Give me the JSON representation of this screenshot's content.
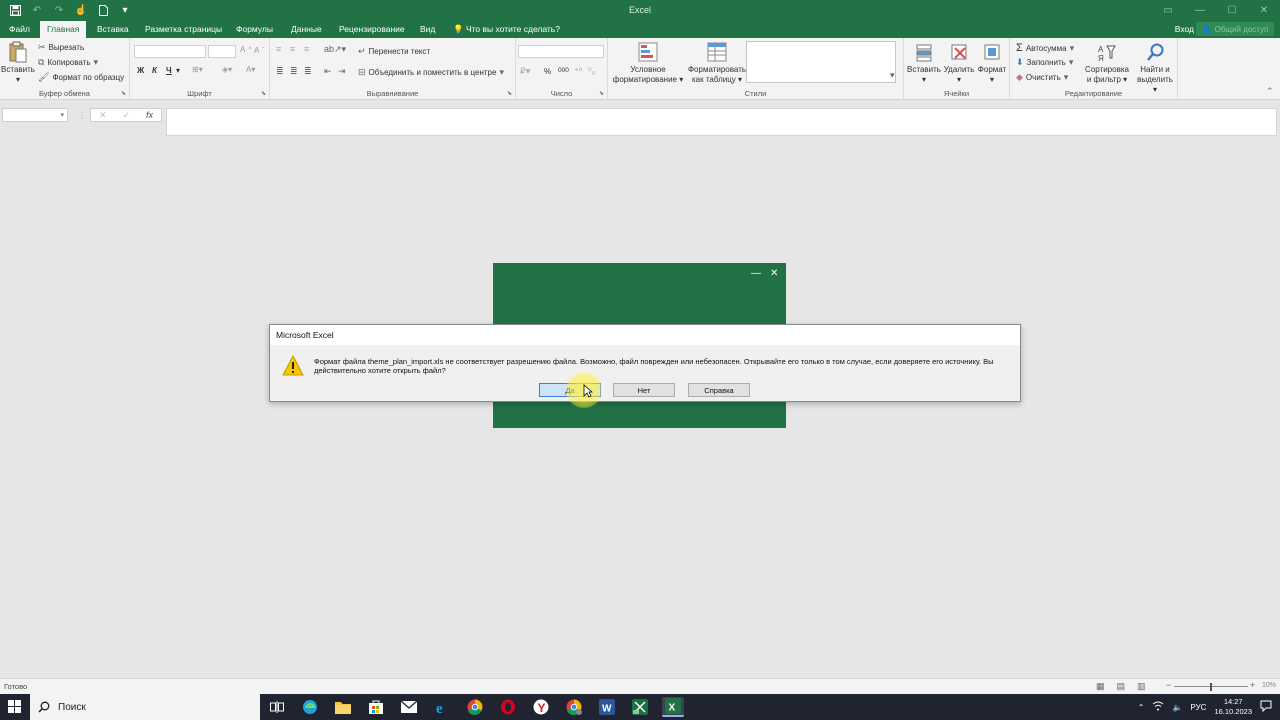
{
  "app": {
    "title": "Excel",
    "icons": {
      "save": "save-icon",
      "undo": "undo-icon",
      "redo": "redo-icon",
      "touch": "touch-mode-icon",
      "new": "new-file-icon",
      "customize": "customize-qat-icon"
    }
  },
  "window": {
    "restore": "ribbon-display-icon",
    "minimize": "minimize-icon",
    "maximize": "maximize-icon",
    "close": "close-icon"
  },
  "tabs": [
    {
      "label": "Файл"
    },
    {
      "label": "Главная"
    },
    {
      "label": "Вставка"
    },
    {
      "label": "Разметка страницы"
    },
    {
      "label": "Формулы"
    },
    {
      "label": "Данные"
    },
    {
      "label": "Рецензирование"
    },
    {
      "label": "Вид"
    },
    {
      "label": "Что вы хотите сделать?"
    }
  ],
  "account": {
    "signin": "Вход",
    "share": "Общий доступ"
  },
  "ribbon": {
    "clipboard": {
      "label": "Буфер обмена",
      "paste": "Вставить",
      "cut": "Вырезать",
      "copy": "Копировать",
      "format_painter": "Формат по образцу"
    },
    "font": {
      "label": "Шрифт",
      "bold": "Ж",
      "italic": "К",
      "underline": "Ч",
      "grow": "A",
      "shrink": "A"
    },
    "alignment": {
      "label": "Выравнивание",
      "wrap": "Перенести текст",
      "merge": "Объединить и поместить в центре"
    },
    "number": {
      "label": "Число",
      "percent": "%",
      "thousands": "000"
    },
    "styles": {
      "label": "Стили",
      "conditional_1": "Условное",
      "conditional_2": "форматирование",
      "table_1": "Форматировать",
      "table_2": "как таблицу"
    },
    "cells": {
      "label": "Ячейки",
      "insert": "Вставить",
      "delete": "Удалить",
      "format": "Формат"
    },
    "editing": {
      "label": "Редактирование",
      "autosum": "Автосумма",
      "fill": "Заполнить",
      "clear": "Очистить",
      "sort_1": "Сортировка",
      "sort_2": "и фильтр",
      "find_1": "Найти и",
      "find_2": "выделить"
    }
  },
  "formula_bar": {
    "cancel": "✕",
    "enter": "✓",
    "fx": "fx"
  },
  "dialog": {
    "title": "Microsoft Excel",
    "message": "Формат файла theme_plan_import.xls не соответствует разрешению файла. Возможно, файл поврежден или небезопасен. Открывайте его только в том случае, если доверяете его источнику. Вы действительно хотите открыть файл?",
    "buttons": {
      "yes": "Да",
      "no": "Нет",
      "help": "Справка"
    }
  },
  "status": {
    "text": "Готово",
    "zoom": "10%"
  },
  "taskbar": {
    "search": "Поиск",
    "lang": "РУС",
    "time": "14:27",
    "date": "16.10.2023",
    "apps": [
      "task-view-icon",
      "edge-icon",
      "file-explorer-icon",
      "store-icon",
      "mail-icon",
      "ie-icon",
      "chrome-icon",
      "opera-icon",
      "yandex-icon",
      "chrome-profile-icon",
      "word-icon",
      "excel-icon",
      "excel-active-icon"
    ]
  },
  "colors": {
    "brand": "#217346",
    "taskbar": "#1f2430",
    "dialog_default": "#cfe3f8"
  }
}
